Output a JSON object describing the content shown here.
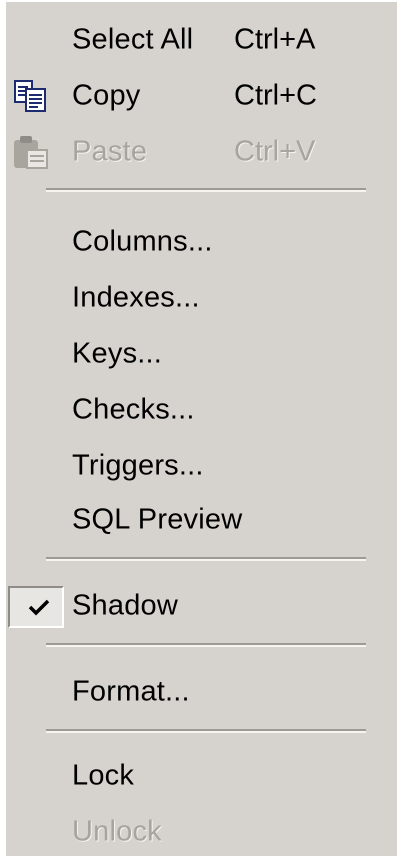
{
  "menu": {
    "items": [
      {
        "label": "Select All",
        "shortcut": "Ctrl+A",
        "icon": "none",
        "enabled": true
      },
      {
        "label": "Copy",
        "shortcut": "Ctrl+C",
        "icon": "copy-icon",
        "enabled": true
      },
      {
        "label": "Paste",
        "shortcut": "Ctrl+V",
        "icon": "paste-icon",
        "enabled": false
      },
      {
        "label": "Columns..."
      },
      {
        "label": "Indexes..."
      },
      {
        "label": "Keys..."
      },
      {
        "label": "Checks..."
      },
      {
        "label": "Triggers..."
      },
      {
        "label": "SQL Preview"
      },
      {
        "label": "Shadow",
        "checked": true,
        "icon": "checkmark-icon"
      },
      {
        "label": "Format..."
      },
      {
        "label": "Lock",
        "enabled": true
      },
      {
        "label": "Unlock",
        "enabled": false
      }
    ]
  },
  "colors": {
    "menu_background": "#d6d3ce",
    "text": "#000000",
    "disabled_text": "#a7a49f",
    "separator_dark": "#9d9a95",
    "separator_light": "#f5f4f1"
  }
}
